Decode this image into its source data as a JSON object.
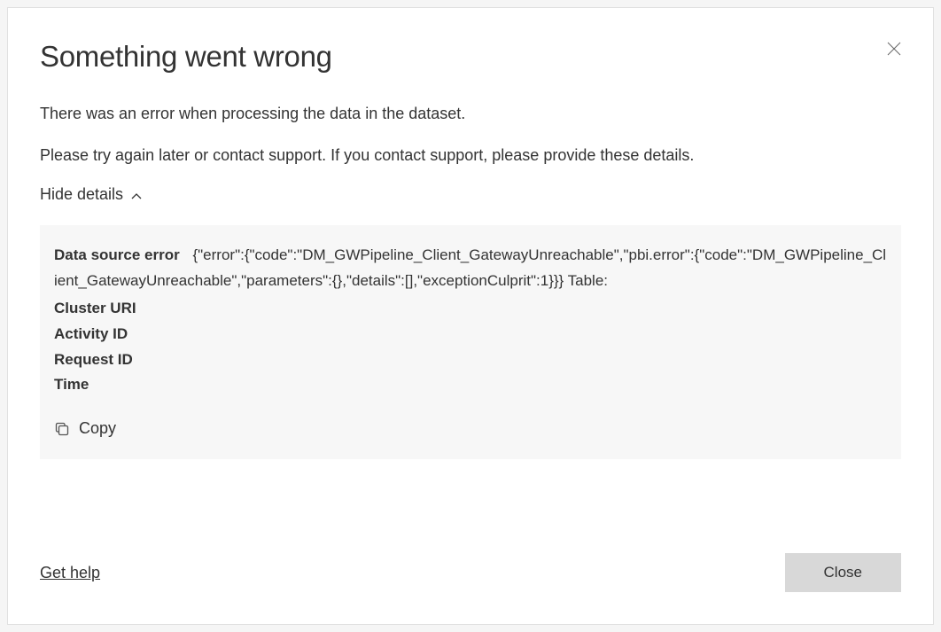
{
  "dialog": {
    "title": "Something went wrong",
    "message_line1": "There was an error when processing the data in the dataset.",
    "message_line2": "Please try again later or contact support. If you contact support, please provide these details.",
    "toggle_label": "Hide details",
    "details": {
      "data_source_error_label": "Data source error",
      "data_source_error_value": "{\"error\":{\"code\":\"DM_GWPipeline_Client_GatewayUnreachable\",\"pbi.error\":{\"code\":\"DM_GWPipeline_Client_GatewayUnreachable\",\"parameters\":{},\"details\":[],\"exceptionCulprit\":1}}} Table:",
      "cluster_uri_label": "Cluster URI",
      "cluster_uri_value": "",
      "activity_id_label": "Activity ID",
      "activity_id_value": "",
      "request_id_label": "Request ID",
      "request_id_value": "",
      "time_label": "Time",
      "time_value": ""
    },
    "copy_label": "Copy",
    "help_label": "Get help",
    "close_label": "Close"
  }
}
